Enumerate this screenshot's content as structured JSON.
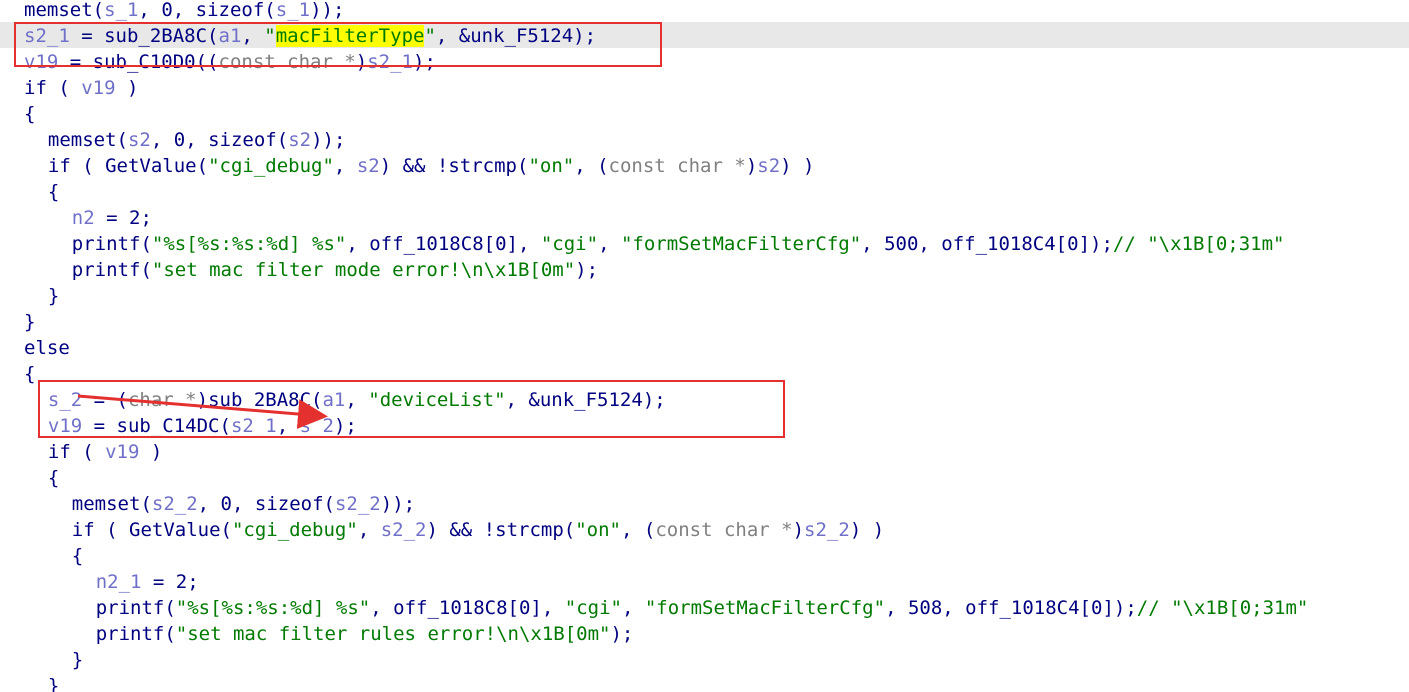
{
  "code_lines": [
    {
      "indent": "",
      "text": "memset(s_1, 0, sizeof(s_1));"
    },
    {
      "indent": "",
      "text": "s2_1 = sub_2BA8C(a1, \"macFilterType\", &unk_F5124);",
      "current": true
    },
    {
      "indent": "",
      "text": "v19 = sub_C10D0((const char *)s2_1);"
    },
    {
      "indent": "",
      "text": "if ( v19 )"
    },
    {
      "indent": "",
      "text": "{"
    },
    {
      "indent": "  ",
      "text": "memset(s2, 0, sizeof(s2));"
    },
    {
      "indent": "  ",
      "text": "if ( GetValue(\"cgi_debug\", s2) && !strcmp(\"on\", (const char *)s2) )"
    },
    {
      "indent": "  ",
      "text": "{"
    },
    {
      "indent": "    ",
      "text": "n2 = 2;"
    },
    {
      "indent": "    ",
      "text": "printf(\"%s[%s:%s:%d] %s\", off_1018C8[0], \"cgi\", \"formSetMacFilterCfg\", 500, off_1018C4[0]);// \"\\x1B[0;31m\""
    },
    {
      "indent": "    ",
      "text": "printf(\"set mac filter mode error!\\n\\x1B[0m\");"
    },
    {
      "indent": "  ",
      "text": "}"
    },
    {
      "indent": "",
      "text": "}"
    },
    {
      "indent": "",
      "text": "else"
    },
    {
      "indent": "",
      "text": "{"
    },
    {
      "indent": "  ",
      "text": "s_2 = (char *)sub_2BA8C(a1, \"deviceList\", &unk_F5124);"
    },
    {
      "indent": "  ",
      "text": "v19 = sub_C14DC(s2_1, s_2);"
    },
    {
      "indent": "  ",
      "text": "if ( v19 )"
    },
    {
      "indent": "  ",
      "text": "{"
    },
    {
      "indent": "    ",
      "text": "memset(s2_2, 0, sizeof(s2_2));"
    },
    {
      "indent": "    ",
      "text": "if ( GetValue(\"cgi_debug\", s2_2) && !strcmp(\"on\", (const char *)s2_2) )"
    },
    {
      "indent": "    ",
      "text": "{"
    },
    {
      "indent": "      ",
      "text": "n2_1 = 2;"
    },
    {
      "indent": "      ",
      "text": "printf(\"%s[%s:%s:%d] %s\", off_1018C8[0], \"cgi\", \"formSetMacFilterCfg\", 508, off_1018C4[0]);// \"\\x1B[0;31m\""
    },
    {
      "indent": "      ",
      "text": "printf(\"set mac filter rules error!\\n\\x1B[0m\");"
    },
    {
      "indent": "    ",
      "text": "}"
    },
    {
      "indent": "  ",
      "text": "}"
    }
  ],
  "highlighted_token": "macFilterType",
  "colors": {
    "keyword": "#000080",
    "variable": "#7070c8",
    "string": "#007a00",
    "cast": "#808080",
    "annotation": "#e53030",
    "highlight": "#ffff00"
  }
}
